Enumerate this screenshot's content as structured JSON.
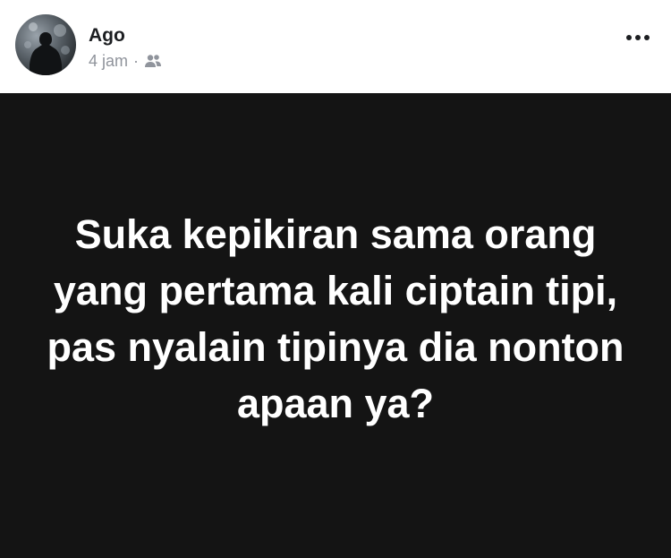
{
  "post": {
    "author": {
      "name": "Ago"
    },
    "meta": {
      "time": "4 jam",
      "separator": "·",
      "audience_icon": "friends-icon"
    },
    "menu_icon": "more-options-icon",
    "status": {
      "text": "Suka kepikiran sama orang yang pertama kali ciptain tipi, pas nyalain tipinya dia nonton apaan ya?",
      "background": "#141414",
      "text_color": "#ffffff"
    }
  }
}
